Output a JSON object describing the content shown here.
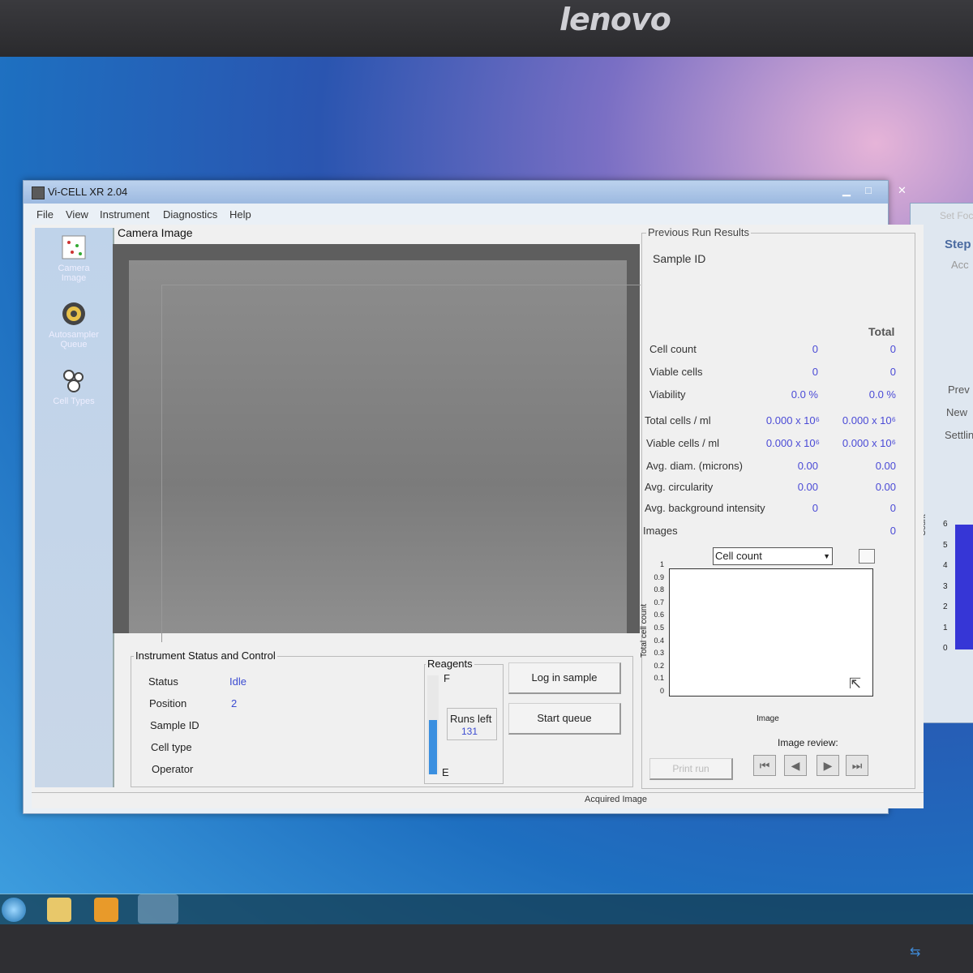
{
  "monitor": {
    "brand": "lenovo"
  },
  "window": {
    "title": "Vi-CELL XR 2.04"
  },
  "menu": [
    "File",
    "View",
    "Instrument",
    "Diagnostics",
    "Help"
  ],
  "sidebar": [
    {
      "label": "Camera\nImage",
      "icon": "camera-image-icon"
    },
    {
      "label": "Autosampler\nQueue",
      "icon": "autosampler-queue-icon"
    },
    {
      "label": "Cell Types",
      "icon": "cell-types-icon"
    }
  ],
  "camera": {
    "title": "Camera Image"
  },
  "status": {
    "title": "Instrument Status and Control",
    "rows": [
      {
        "label": "Status",
        "value": "Idle"
      },
      {
        "label": "Position",
        "value": "2"
      },
      {
        "label": "Sample ID",
        "value": ""
      },
      {
        "label": "Cell type",
        "value": ""
      },
      {
        "label": "Operator",
        "value": ""
      }
    ]
  },
  "reagents": {
    "title": "Reagents",
    "full_label": "F",
    "empty_label": "E",
    "runs_left_label": "Runs left",
    "runs_left_value": "131",
    "level": 0.55
  },
  "buttons": {
    "log_in_sample": "Log in sample",
    "start_queue": "Start queue",
    "print_run": "Print run"
  },
  "results": {
    "title": "Previous Run Results",
    "sample_id_label": "Sample ID",
    "total_header": "Total",
    "rows": [
      {
        "label": "Cell count",
        "value": "0",
        "total": "0"
      },
      {
        "label": "Viable cells",
        "value": "0",
        "total": "0"
      },
      {
        "label": "Viability",
        "value": "0.0 %",
        "total": "0.0 %"
      },
      {
        "label": "Total cells / ml",
        "value": "0.000  x 10⁶",
        "total": "0.000  x 10⁶"
      },
      {
        "label": "Viable cells / ml",
        "value": "0.000  x 10⁶",
        "total": "0.000  x 10⁶"
      },
      {
        "label": "Avg. diam. (microns)",
        "value": "0.00",
        "total": "0.00"
      },
      {
        "label": "Avg. circularity",
        "value": "0.00",
        "total": "0.00"
      },
      {
        "label": "Avg. background intensity",
        "value": "0",
        "total": "0"
      },
      {
        "label": "Images",
        "value": "",
        "total": "0"
      }
    ]
  },
  "plot": {
    "select_value": "Cell count",
    "ylabel": "Total cell count",
    "xlabel": "Image",
    "yticks": [
      "1",
      "0.9",
      "0.8",
      "0.7",
      "0.6",
      "0.5",
      "0.4",
      "0.3",
      "0.2",
      "0.1",
      "0"
    ]
  },
  "image_review": {
    "label": "Image review:"
  },
  "status_bar": {
    "text": "Acquired Image"
  },
  "side_panel": {
    "texts": [
      "Set Foc",
      "Step",
      "Acc",
      "Prev",
      "New",
      "Settlin"
    ],
    "ylabel": "Count",
    "yticks": [
      "6",
      "5",
      "4",
      "3",
      "2",
      "1",
      "0"
    ]
  }
}
